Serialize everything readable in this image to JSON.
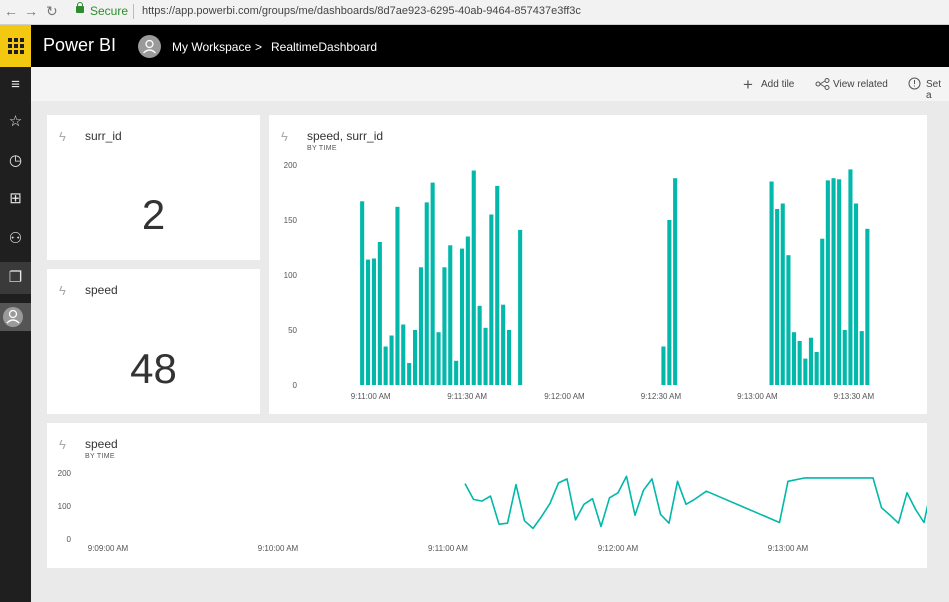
{
  "browser": {
    "secure_label": "Secure",
    "url": "https://app.powerbi.com/groups/me/dashboards/8d7ae923-6295-40ab-9464-857437e3ff3c"
  },
  "app": {
    "brand": "Power BI",
    "breadcrumb": {
      "workspace": "My Workspace",
      "separator": ">",
      "dashboard": "RealtimeDashboard"
    }
  },
  "actions": {
    "add_tile": "Add tile",
    "view_related": "View related",
    "set_alert": "Set a"
  },
  "rail_icons": [
    "app-launcher-icon",
    "menu-icon",
    "favorites-star-icon",
    "recent-clock-icon",
    "apps-icon",
    "shared-with-me-icon",
    "workspaces-icon",
    "user-avatar-icon"
  ],
  "tiles": {
    "card1": {
      "title": "surr_id",
      "value": "2"
    },
    "card2": {
      "title": "speed",
      "value": "48"
    },
    "bar": {
      "title": "speed, surr_id",
      "subtitle": "BY TIME"
    },
    "line": {
      "title": "speed",
      "subtitle": "BY TIME"
    }
  },
  "chart_data": [
    {
      "type": "bar",
      "title": "speed, surr_id",
      "subtitle": "BY TIME",
      "color": "#01b8aa",
      "ylim": [
        0,
        200
      ],
      "y_ticks": [
        "0",
        "50",
        "100",
        "150",
        "200"
      ],
      "x_ticks": [
        "9:11:00 AM",
        "9:11:30 AM",
        "9:12:00 AM",
        "9:12:30 AM",
        "9:13:00 AM",
        "9:13:30 AM"
      ],
      "grid": false,
      "values": [
        167,
        114,
        115,
        130,
        35,
        45,
        162,
        55,
        20,
        50,
        107,
        166,
        184,
        48,
        107,
        127,
        22,
        124,
        135,
        195,
        52,
        155,
        181,
        73,
        50,
        170,
        40,
        120,
        51,
        141,
        146,
        192,
        106,
        182,
        90,
        43,
        26,
        88,
        82,
        127,
        122,
        151,
        157,
        132,
        128,
        190,
        63,
        141,
        150,
        127,
        139,
        148
      ],
      "groups": [
        {
          "start_x": 9.9,
          "step": 1.0,
          "values": [
            167,
            114,
            115,
            130,
            35,
            45,
            162,
            55,
            20,
            50,
            107,
            166,
            184,
            48,
            107,
            127,
            22,
            124,
            135,
            195,
            72,
            52,
            155,
            181,
            73,
            50
          ]
        },
        {
          "start_x": 36.8,
          "step": 1.0,
          "values": [
            141
          ]
        },
        {
          "start_x": 61.2,
          "step": 1.0,
          "values": [
            35,
            150,
            188
          ]
        },
        {
          "start_x": 79.6,
          "step": 0.96,
          "values": [
            185,
            160,
            165,
            118,
            48,
            40,
            24,
            43,
            30,
            133,
            186,
            188,
            187,
            50,
            196,
            165,
            49,
            142
          ]
        }
      ]
    },
    {
      "type": "line",
      "title": "speed",
      "subtitle": "BY TIME",
      "color": "#01b8aa",
      "ylim": [
        0,
        200
      ],
      "y_ticks": [
        "0",
        "100",
        "200"
      ],
      "x_ticks": [
        "9:09:00 AM",
        "9:10:00 AM",
        "9:11:00 AM",
        "9:12:00 AM",
        "9:13:00 AM"
      ],
      "grid": false,
      "points": [
        [
          11.1,
          168
        ],
        [
          11.15,
          120
        ],
        [
          11.2,
          115
        ],
        [
          11.25,
          130
        ],
        [
          11.3,
          45
        ],
        [
          11.35,
          48
        ],
        [
          11.4,
          165
        ],
        [
          11.45,
          55
        ],
        [
          11.5,
          32
        ],
        [
          11.55,
          68
        ],
        [
          11.6,
          108
        ],
        [
          11.65,
          170
        ],
        [
          11.7,
          182
        ],
        [
          11.75,
          58
        ],
        [
          11.8,
          105
        ],
        [
          11.85,
          122
        ],
        [
          11.9,
          38
        ],
        [
          11.95,
          125
        ],
        [
          12.0,
          140
        ],
        [
          12.05,
          190
        ],
        [
          12.1,
          72
        ],
        [
          12.15,
          148
        ],
        [
          12.2,
          182
        ],
        [
          12.25,
          75
        ],
        [
          12.3,
          48
        ],
        [
          12.35,
          175
        ],
        [
          12.4,
          105
        ],
        [
          12.45,
          120
        ],
        [
          12.52,
          145
        ],
        [
          12.95,
          50
        ],
        [
          13.0,
          175
        ],
        [
          13.1,
          185
        ],
        [
          13.5,
          185
        ],
        [
          13.55,
          95
        ],
        [
          13.6,
          72
        ],
        [
          13.65,
          48
        ],
        [
          13.7,
          140
        ],
        [
          13.75,
          90
        ],
        [
          13.8,
          50
        ],
        [
          13.85,
          172
        ],
        [
          13.9,
          168
        ],
        [
          13.95,
          125
        ],
        [
          14.0,
          195
        ],
        [
          14.05,
          190
        ],
        [
          14.1,
          80
        ]
      ]
    }
  ]
}
